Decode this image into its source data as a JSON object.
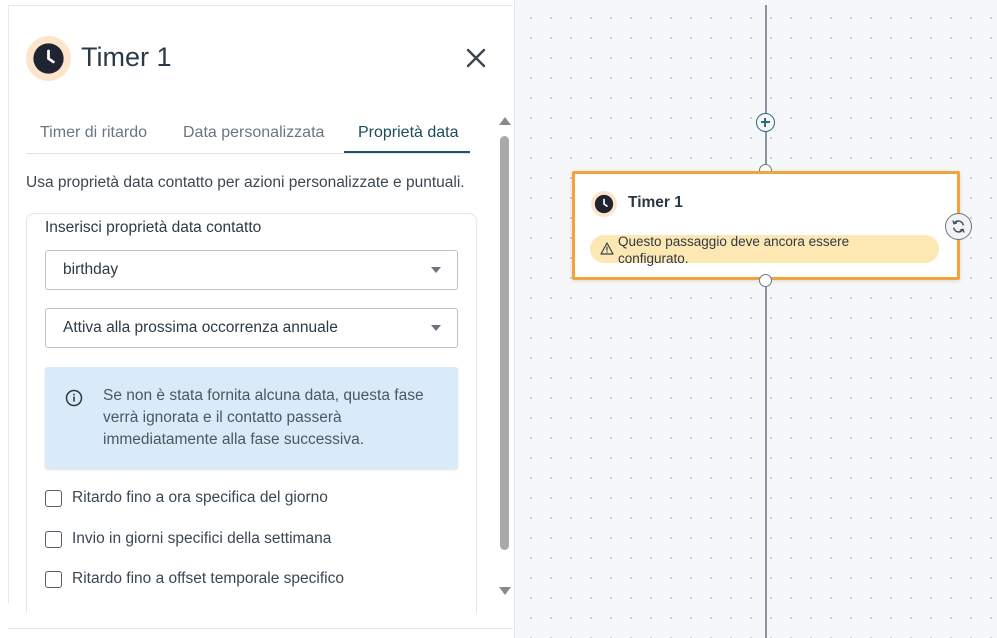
{
  "panel": {
    "title": "Timer 1",
    "tabs": [
      {
        "label": "Timer di ritardo",
        "active": false
      },
      {
        "label": "Data personalizzata",
        "active": false
      },
      {
        "label": "Proprietà data",
        "active": true
      }
    ],
    "description": "Usa proprietà data contatto per azioni personalizzate e puntuali.",
    "section_label": "Inserisci proprietà data contatto",
    "property_select": {
      "value": "birthday"
    },
    "trigger_select": {
      "value": "Attiva alla prossima occorrenza annuale"
    },
    "info_text": "Se non è stata fornita alcuna data, questa fase verrà ignorata e il contatto passerà immediatamente alla fase successiva.",
    "checkboxes": [
      {
        "label": "Ritardo fino a ora specifica del giorno",
        "checked": false
      },
      {
        "label": "Invio in giorni specifici della settimana",
        "checked": false
      },
      {
        "label": "Ritardo fino a offset temporale specifico",
        "checked": false
      }
    ]
  },
  "canvas": {
    "node": {
      "title": "Timer 1",
      "warning": "Questo passaggio deve ancora essere configurato."
    }
  },
  "colors": {
    "accent": "#1f5666",
    "node_border": "#f2a33a",
    "warning_bg": "#fde8b4",
    "info_bg": "#d9ebf9",
    "icon_bg": "#fde5cc"
  },
  "icons": {
    "header": "clock-icon",
    "close": "close-icon",
    "info": "info-icon",
    "warning": "warning-icon",
    "add": "plus-circle-icon",
    "sync": "sync-icon"
  }
}
